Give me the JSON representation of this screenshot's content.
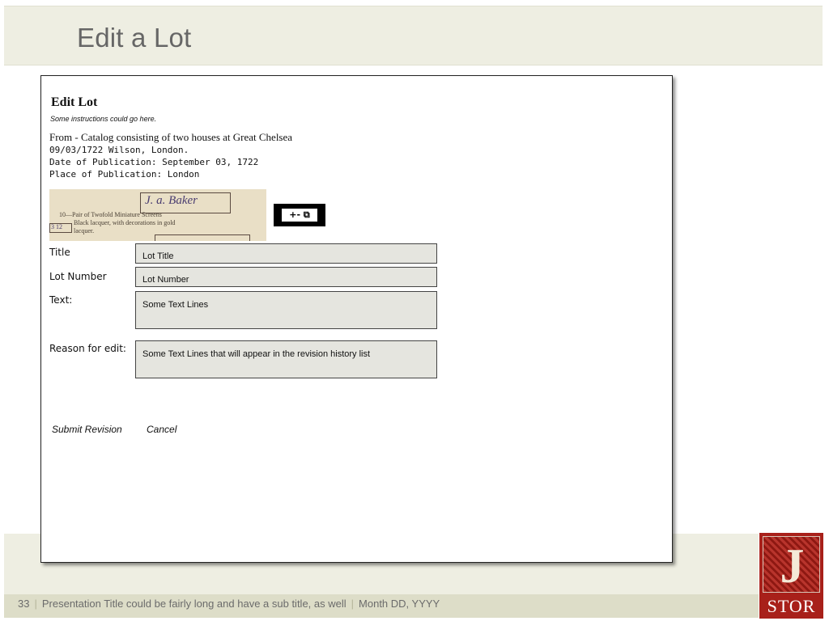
{
  "slide": {
    "title": "Edit a Lot",
    "footer": {
      "page": "33",
      "presentation_title": "Presentation Title could be fairly long and have a sub title, as well",
      "date": "Month DD, YYYY"
    },
    "logo": {
      "letter": "J",
      "wordmark": "STOR"
    }
  },
  "form": {
    "title": "Edit Lot",
    "instructions": "Some instructions could go here.",
    "from_line": "From - Catalog consisting of two houses at Great Chelsea",
    "date_line": "09/03/1722 Wilson, London.",
    "pub_date_line": "Date of Publication: September 03, 1722",
    "pub_place_line": "Place of Publication: London",
    "thumbnail": {
      "line1": "10—Pair of Twofold Miniature Screens",
      "line2": "Black lacquer, with decorations in gold",
      "line3": "lacquer.",
      "margin_note": "3 12",
      "signature": "J. a. Baker"
    },
    "zoom_controls": "+-  ⧉",
    "fields": {
      "title_label": "Title",
      "title_value": "Lot Title",
      "lot_number_label": "Lot Number",
      "lot_number_value": "Lot Number",
      "text_label": "Text:",
      "text_value": "Some Text Lines",
      "reason_label": "Reason for edit:",
      "reason_value": "Some Text Lines that will appear in the revision history list"
    },
    "actions": {
      "submit": "Submit Revision",
      "cancel": "Cancel"
    }
  }
}
